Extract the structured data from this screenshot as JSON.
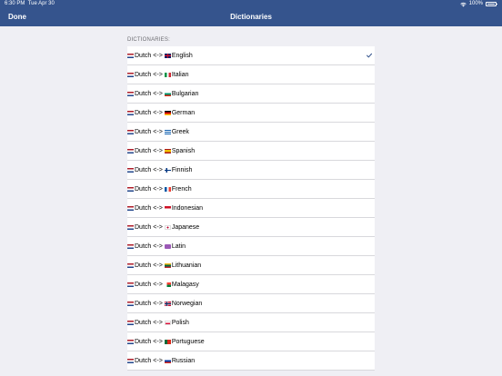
{
  "status": {
    "time": "6:30 PM",
    "date": "Tue Apr 30",
    "battery": "100%"
  },
  "nav": {
    "done": "Done",
    "title": "Dictionaries"
  },
  "section_header": "DICTIONARIES:",
  "colors": {
    "bar": "#35548d",
    "checkmark": "#35548d",
    "background": "#efeff4"
  },
  "dictionaries": [
    {
      "from_flag": "nl",
      "from": "Dutch",
      "arrow": "<->",
      "to_flag": "gb",
      "to": "English",
      "checked": true
    },
    {
      "from_flag": "nl",
      "from": "Dutch",
      "arrow": "<->",
      "to_flag": "it",
      "to": "Italian",
      "checked": false
    },
    {
      "from_flag": "nl",
      "from": "Dutch",
      "arrow": "<->",
      "to_flag": "bg",
      "to": "Bulgarian",
      "checked": false
    },
    {
      "from_flag": "nl",
      "from": "Dutch",
      "arrow": "<->",
      "to_flag": "de",
      "to": "German",
      "checked": false
    },
    {
      "from_flag": "nl",
      "from": "Dutch",
      "arrow": "<->",
      "to_flag": "gr",
      "to": "Greek",
      "checked": false
    },
    {
      "from_flag": "nl",
      "from": "Dutch",
      "arrow": "<->",
      "to_flag": "es",
      "to": "Spanish",
      "checked": false
    },
    {
      "from_flag": "nl",
      "from": "Dutch",
      "arrow": "<->",
      "to_flag": "fi",
      "to": "Finnish",
      "checked": false
    },
    {
      "from_flag": "nl",
      "from": "Dutch",
      "arrow": "<->",
      "to_flag": "fr",
      "to": "French",
      "checked": false
    },
    {
      "from_flag": "nl",
      "from": "Dutch",
      "arrow": "<->",
      "to_flag": "id",
      "to": "Indonesian",
      "checked": false
    },
    {
      "from_flag": "nl",
      "from": "Dutch",
      "arrow": "<->",
      "to_flag": "jp",
      "to": "Japanese",
      "checked": false
    },
    {
      "from_flag": "nl",
      "from": "Dutch",
      "arrow": "<->",
      "to_flag": "la",
      "to": "Latin",
      "checked": false
    },
    {
      "from_flag": "nl",
      "from": "Dutch",
      "arrow": "<->",
      "to_flag": "lt",
      "to": "Lithuanian",
      "checked": false
    },
    {
      "from_flag": "nl",
      "from": "Dutch",
      "arrow": "<->",
      "to_flag": "mg",
      "to": "Malagasy",
      "checked": false
    },
    {
      "from_flag": "nl",
      "from": "Dutch",
      "arrow": "<->",
      "to_flag": "no",
      "to": "Norwegian",
      "checked": false
    },
    {
      "from_flag": "nl",
      "from": "Dutch",
      "arrow": "<->",
      "to_flag": "pl",
      "to": "Polish",
      "checked": false
    },
    {
      "from_flag": "nl",
      "from": "Dutch",
      "arrow": "<->",
      "to_flag": "pt",
      "to": "Portuguese",
      "checked": false
    },
    {
      "from_flag": "nl",
      "from": "Dutch",
      "arrow": "<->",
      "to_flag": "ru",
      "to": "Russian",
      "checked": false
    }
  ]
}
